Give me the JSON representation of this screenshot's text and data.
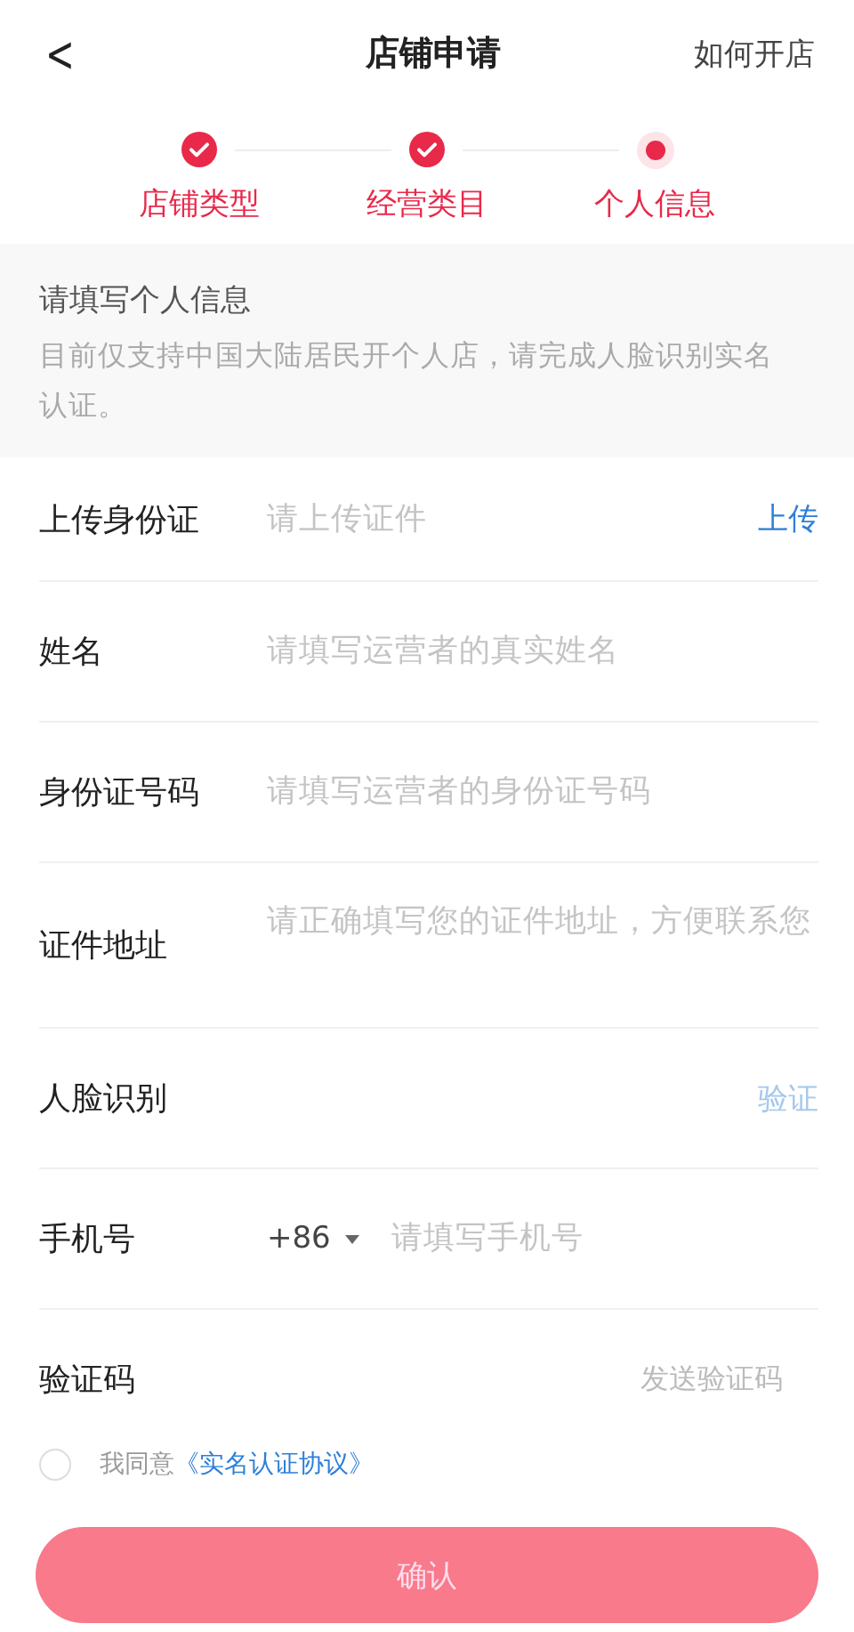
{
  "header": {
    "back": "<",
    "title": "店铺申请",
    "link": "如何开店"
  },
  "steps": [
    {
      "label": "店铺类型",
      "done": true
    },
    {
      "label": "经营类目",
      "done": true
    },
    {
      "label": "个人信息",
      "done": false
    }
  ],
  "notice": {
    "title": "请填写个人信息",
    "text": "目前仅支持中国大陆居民开个人店，请完成人脸识别实名认证。"
  },
  "fields": [
    {
      "kind": "action",
      "label": "上传身份证",
      "placeholder": "请上传证件",
      "action": "上传",
      "disabled": false
    },
    {
      "kind": "text",
      "label": "姓名",
      "placeholder": "请填写运营者的真实姓名"
    },
    {
      "kind": "text",
      "label": "身份证号码",
      "placeholder": "请填写运营者的身份证号码"
    },
    {
      "kind": "textarea",
      "label": "证件地址",
      "placeholder": "请正确填写您的证件地址，方便联系您"
    },
    {
      "kind": "action",
      "label": "人脸识别",
      "action": "验证",
      "disabled": true
    },
    {
      "kind": "phone",
      "label": "手机号",
      "code": "+86",
      "placeholder": "请填写手机号"
    },
    {
      "kind": "sms",
      "label": "验证码",
      "action": "发送验证码"
    }
  ],
  "agreement": {
    "checked": false,
    "text": "我同意",
    "link": "《实名认证协议》"
  },
  "submit": {
    "label": "确认",
    "disabled": true
  }
}
